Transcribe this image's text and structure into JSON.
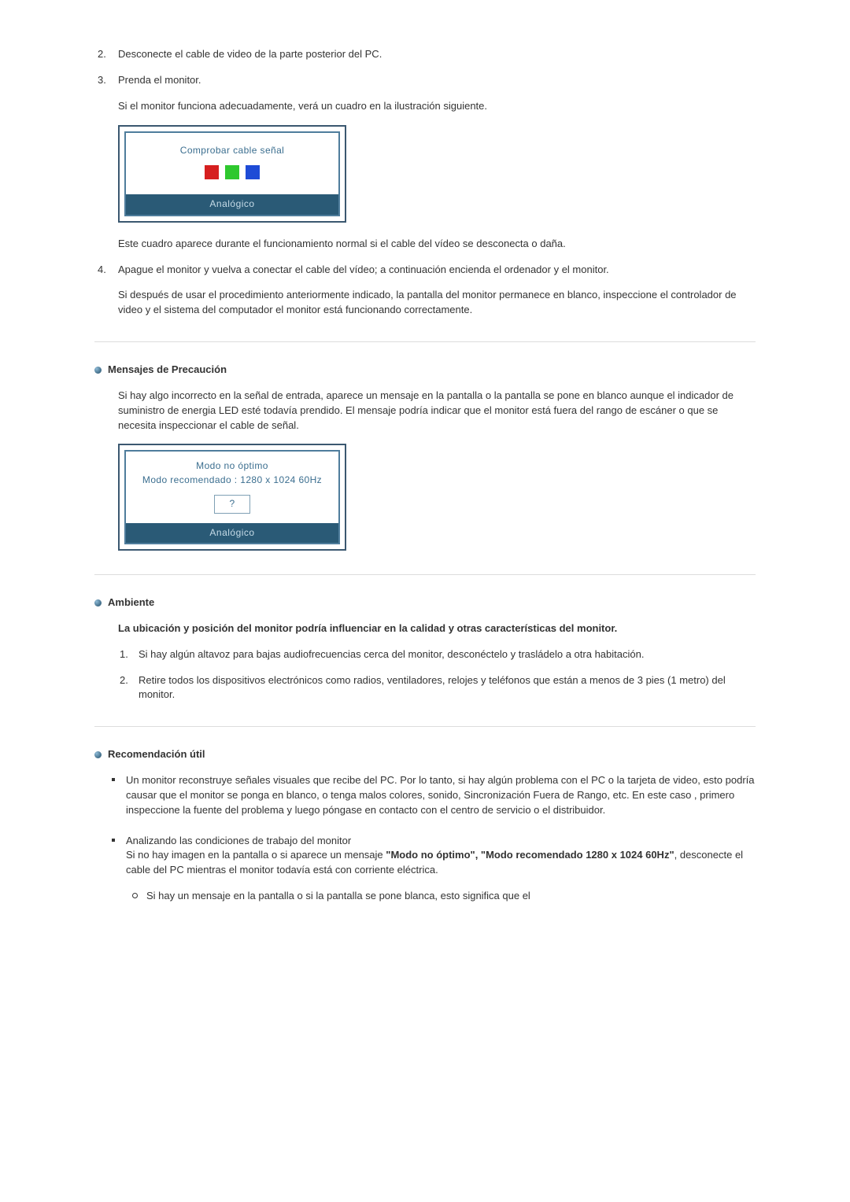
{
  "steps": {
    "s2": "Desconecte el cable de video de la parte posterior del PC.",
    "s3": "Prenda el monitor.",
    "s3_p1": "Si el monitor funciona adecuadamente, verá un cuadro en la ilustración siguiente.",
    "callout1_title": "Comprobar cable señal",
    "callout_footer": "Analógico",
    "s3_p2": "Este cuadro aparece durante el funcionamiento normal si el cable del vídeo se desconecta o daña.",
    "s4": "Apague el monitor y vuelva a conectar el cable del vídeo; a continuación encienda el ordenador y el monitor.",
    "s4_p1": "Si después de usar el procedimiento anteriormente indicado, la pantalla del monitor permanece en blanco, inspeccione el controlador de video y el sistema del computador el monitor está funcionando correctamente."
  },
  "warning": {
    "heading": "Mensajes de Precaución",
    "body": "Si hay algo incorrecto en la señal de entrada, aparece un mensaje en la pantalla o la pantalla se pone en blanco aunque el indicador de suministro de energia LED esté todavía prendido. El mensaje podría indicar que el monitor está fuera del rango de escáner o que se necesita inspeccionar el cable de señal.",
    "callout2_line1": "Modo no óptimo",
    "callout2_line2": "Modo recomendado : 1280 x 1024  60Hz",
    "callout2_q": "?"
  },
  "ambient": {
    "heading": "Ambiente",
    "lead": "La ubicación y posición del monitor podría influenciar en la calidad y otras características del monitor.",
    "li1": "Si hay algún altavoz para bajas audiofrecuencias cerca del monitor, desconéctelo y trasládelo a otra habitación.",
    "li2": "Retire todos los dispositivos electrónicos como radios, ventiladores, relojes y teléfonos que están a menos de 3 pies (1 metro) del monitor."
  },
  "tip": {
    "heading": "Recomendación útil",
    "li1": "Un monitor reconstruye señales visuales que recibe del PC. Por lo tanto, si hay algún problema con el PC o la tarjeta de video, esto podría causar que el monitor se ponga en blanco, o tenga malos colores, sonido, Sincronización Fuera de Rango, etc. En este caso , primero inspeccione la fuente del problema y luego póngase en contacto con el centro de servicio o el distribuidor.",
    "li2_a": "Analizando las condiciones de trabajo del monitor",
    "li2_b_pre": "Si no hay imagen en la pantalla o si aparece un mensaje ",
    "li2_b_bold": "\"Modo no óptimo\", \"Modo recomendado 1280 x 1024 60Hz\"",
    "li2_b_post": ", desconecte el cable del PC mientras el monitor todavía está con corriente eléctrica.",
    "sub1": "Si hay un mensaje en la pantalla o si la pantalla se pone blanca, esto significa que el"
  }
}
